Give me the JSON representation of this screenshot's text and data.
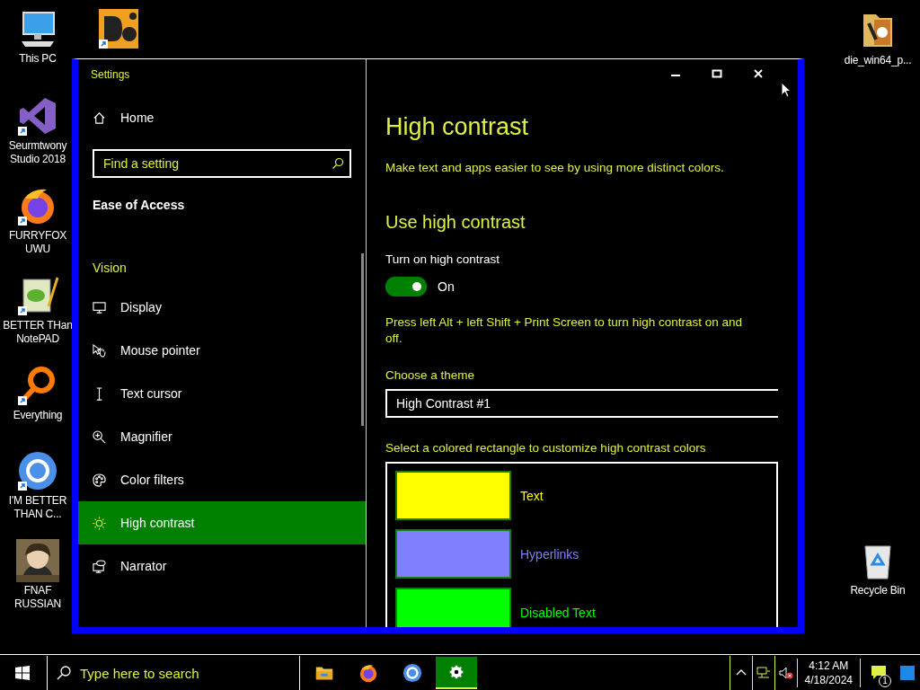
{
  "desktop": {
    "icons": [
      {
        "label": "This PC",
        "kind": "computer"
      },
      {
        "label": "Seurmtwony Studio 2018",
        "kind": "studio"
      },
      {
        "label": "FURRYFOX UWU",
        "kind": "fox"
      },
      {
        "label": "BETTER THan NotePAD",
        "kind": "notepad"
      },
      {
        "label": "Everything",
        "kind": "ring"
      },
      {
        "label": "I'M BETTER THAN C...",
        "kind": "chrome"
      },
      {
        "label": "FNAF RUSSIAN",
        "kind": "picture"
      },
      {
        "label": "die_win64_p...",
        "kind": "folder"
      },
      {
        "label": "Recycle Bin",
        "kind": "bin"
      },
      {
        "kind": "app"
      }
    ]
  },
  "window": {
    "title": "Settings",
    "sidebar": {
      "home": "Home",
      "search": {
        "placeholder": "Find a setting"
      },
      "section": "Ease of Access",
      "group": "Vision",
      "items": [
        {
          "label": "Display",
          "selected": false
        },
        {
          "label": "Mouse pointer",
          "selected": false
        },
        {
          "label": "Text cursor",
          "selected": false
        },
        {
          "label": "Magnifier",
          "selected": false
        },
        {
          "label": "Color filters",
          "selected": false
        },
        {
          "label": "High contrast",
          "selected": true
        },
        {
          "label": "Narrator",
          "selected": false
        }
      ]
    },
    "content": {
      "title": "High contrast",
      "description": "Make text and apps easier to see by using more distinct colors.",
      "heading": "Use high contrast",
      "toggle": {
        "label": "Turn on high contrast",
        "on": true,
        "state_text": "On"
      },
      "hint": "Press left Alt + left Shift + Print Screen to turn high contrast on and off.",
      "theme": {
        "label": "Choose a theme",
        "value": "High Contrast #1"
      },
      "colors_prompt": "Select a colored rectangle to customize high contrast colors",
      "swatches": [
        {
          "label": "Text",
          "color": "#ffff00"
        },
        {
          "label": "Hyperlinks",
          "color": "#8080ff"
        },
        {
          "label": "Disabled Text",
          "color": "#00ff00"
        }
      ]
    }
  },
  "taskbar": {
    "search_placeholder": "Type here to search",
    "apps": [
      {
        "kind": "explorer",
        "selected": false
      },
      {
        "kind": "firefox",
        "selected": false
      },
      {
        "kind": "chrome",
        "selected": false
      },
      {
        "kind": "settings",
        "selected": true
      }
    ],
    "time": "4:12 AM",
    "date": "4/18/2024",
    "notifications": "1"
  }
}
